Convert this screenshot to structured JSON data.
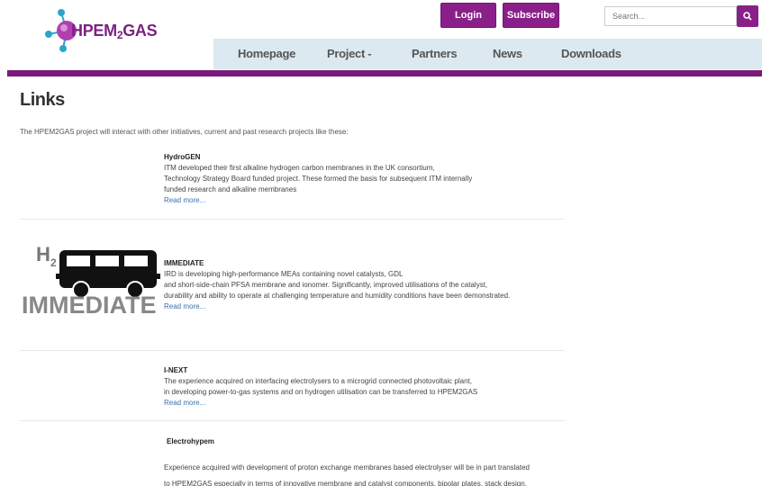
{
  "header": {
    "logo_text_main": "HPEM",
    "logo_text_sub": "2",
    "logo_text_end": "GAS",
    "login_label": "Login",
    "subscribe_label": "Subscribe",
    "search_placeholder": "Search...",
    "brand_color": "#8b1f8a"
  },
  "nav": {
    "items": [
      {
        "label": "Homepage"
      },
      {
        "label": "Project -"
      },
      {
        "label": "Partners"
      },
      {
        "label": "News"
      },
      {
        "label": "Downloads"
      }
    ]
  },
  "main": {
    "title": "Links",
    "intro": "The HPEM2GAS project will interact with other initiatives, current and past research projects like these:",
    "entries": [
      {
        "title": "HydroGEN",
        "lines": [
          "ITM developed their first alkaline hydrogen carbon membranes in the UK consortium,",
          "Technology Strategy Board funded project. These formed the basis for subsequent ITM internally",
          "funded research and alkaline membranes"
        ],
        "read_more": "Read more..."
      },
      {
        "title": "IMMEDIATE",
        "logo_text": "IMMEDIATE",
        "lines": [
          "IRD is developing high-performance MEAs containing novel catalysts, GDL",
          "and short-side-chain PFSA membrane and ionomer. Significantly, improved utilisations of the catalyst,",
          "durability and ability to operate at challenging temperature and humidity conditions have been demonstrated."
        ],
        "read_more": "Read more..."
      },
      {
        "title": "I-NEXT",
        "lines": [
          "The experience acquired on interfacing electrolysers to a microgrid connected photovoltaic plant,",
          "in developing power-to-gas systems and on hydrogen utilisation can be transferred to HPEM2GAS"
        ],
        "read_more": "Read more..."
      },
      {
        "title": "Electrohypem",
        "lines": [
          "Experience acquired with development of proton exchange membranes based electrolyser will  be in part translated",
          "to HPEM2GAS especially in terms of innovative membrane and catalyst components, bipolar plates, stack design,"
        ]
      }
    ]
  }
}
